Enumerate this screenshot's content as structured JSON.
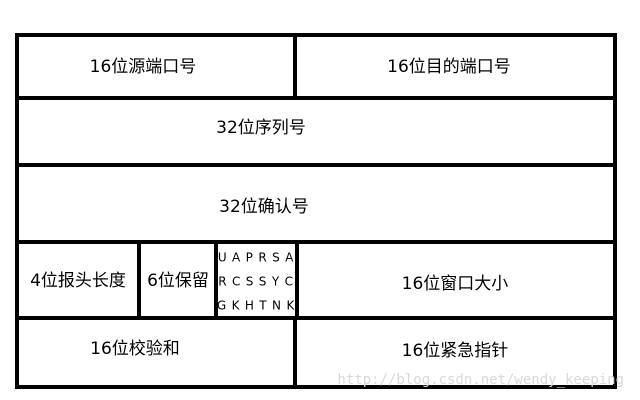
{
  "diagram": {
    "rows": [
      {
        "cells": [
          {
            "label": "16位源端口号"
          },
          {
            "label": "16位目的端口号"
          }
        ]
      },
      {
        "cells": [
          {
            "label": "32位序列号"
          }
        ]
      },
      {
        "cells": [
          {
            "label": "32位确认号"
          }
        ]
      },
      {
        "cells": [
          {
            "label": "4位报头长度"
          },
          {
            "label": "6位保留"
          },
          {
            "flag_rows": [
              "U A P R S A",
              "R C S S Y C",
              "G K H T N K"
            ]
          },
          {
            "label": "16位窗口大小"
          }
        ]
      },
      {
        "cells": [
          {
            "label": "16位校验和"
          },
          {
            "label": "16位紧急指针"
          }
        ]
      }
    ]
  },
  "watermark": "http://blog.csdn.net/wendy_keeping",
  "colors": {
    "border": "#000000",
    "background": "#ffffff",
    "watermark": "#d9d9d9"
  }
}
